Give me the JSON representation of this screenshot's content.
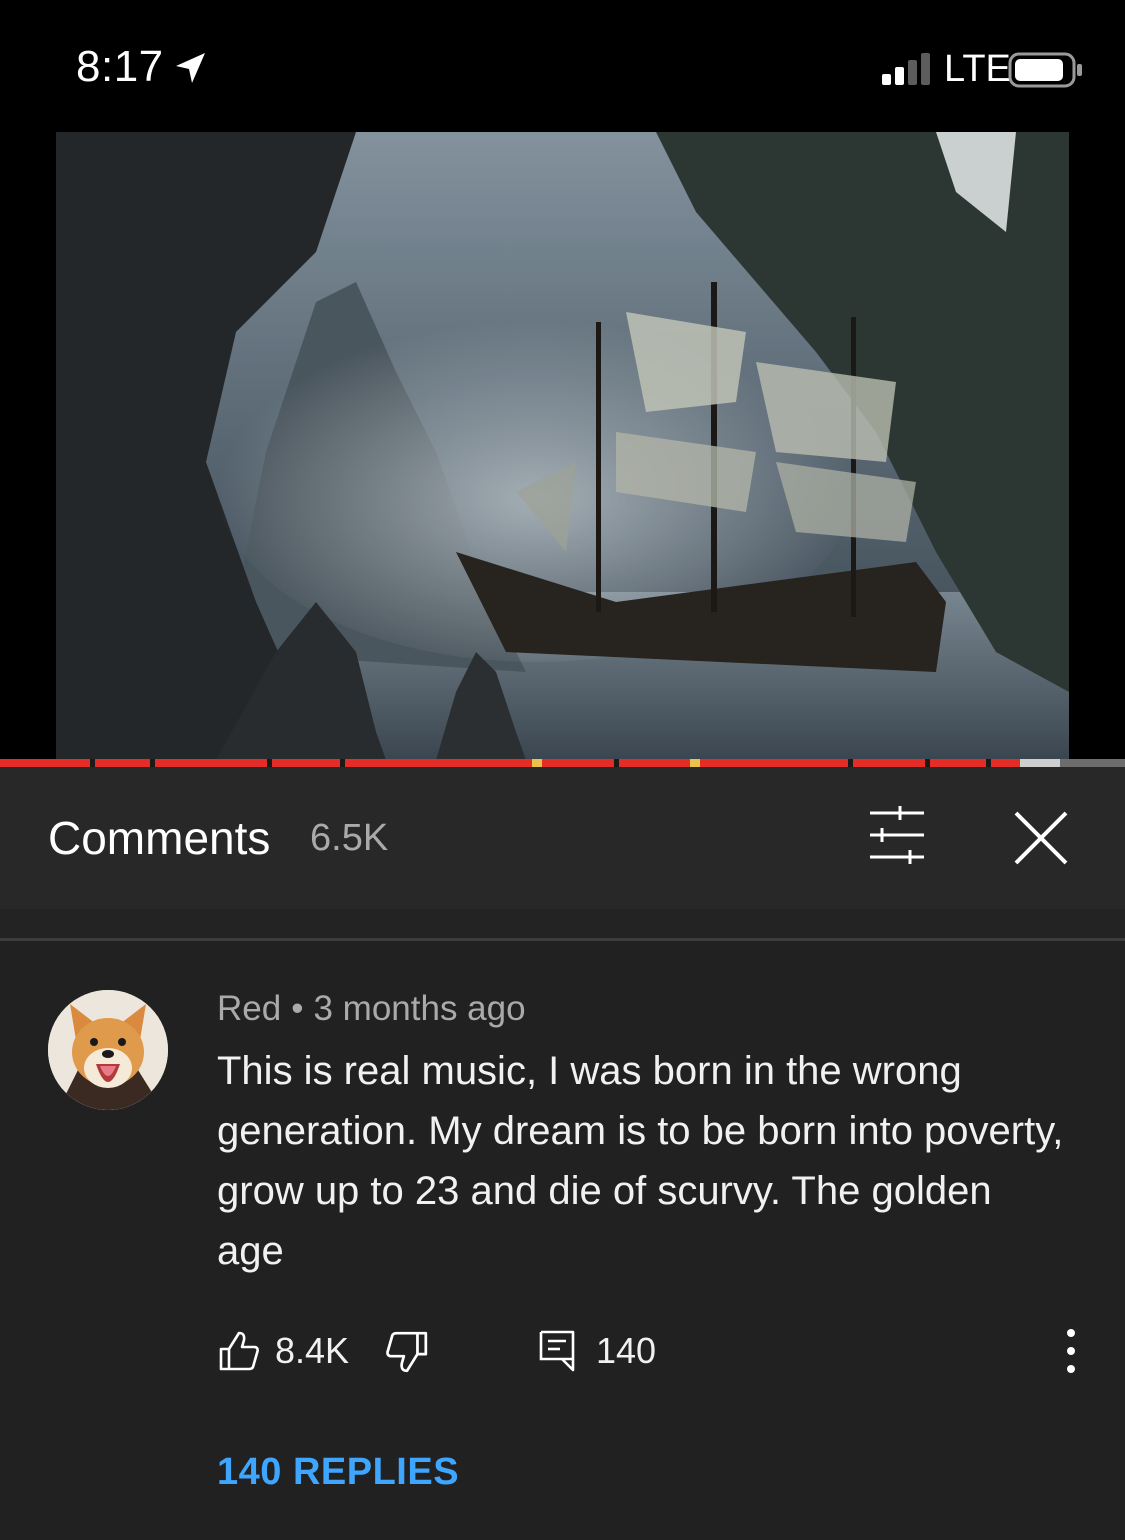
{
  "status_bar": {
    "time": "8:17",
    "carrier": "LTE",
    "icons": [
      "location-arrow-icon",
      "signal-bars-icon",
      "battery-icon"
    ]
  },
  "video": {
    "thumbnail": "ghost-ship-in-misty-cove",
    "progress_fraction": 0.907,
    "buffered_fraction": 0.942
  },
  "comments": {
    "title": "Comments",
    "count": "6.5K",
    "icons": [
      "sort-icon",
      "close-icon"
    ]
  },
  "comment": {
    "author": "Red",
    "separator": "•",
    "time_ago": "3 months ago",
    "text": "This is real music, I was born in the wrong generation. My dream is to be born into poverty, grow up to 23 and die of scurvy. The golden age",
    "likes": "8.4K",
    "reply_count": "140",
    "replies_link": "140 REPLIES",
    "icons": [
      "thumbs-up-icon",
      "thumbs-down-icon",
      "reply-icon",
      "more-vertical-icon"
    ]
  },
  "colors": {
    "accent_blue": "#3ea6ff",
    "progress_red": "#e52d27",
    "panel_bg": "#212121",
    "header_bg": "#282828",
    "secondary_text": "#aaaaaa"
  }
}
